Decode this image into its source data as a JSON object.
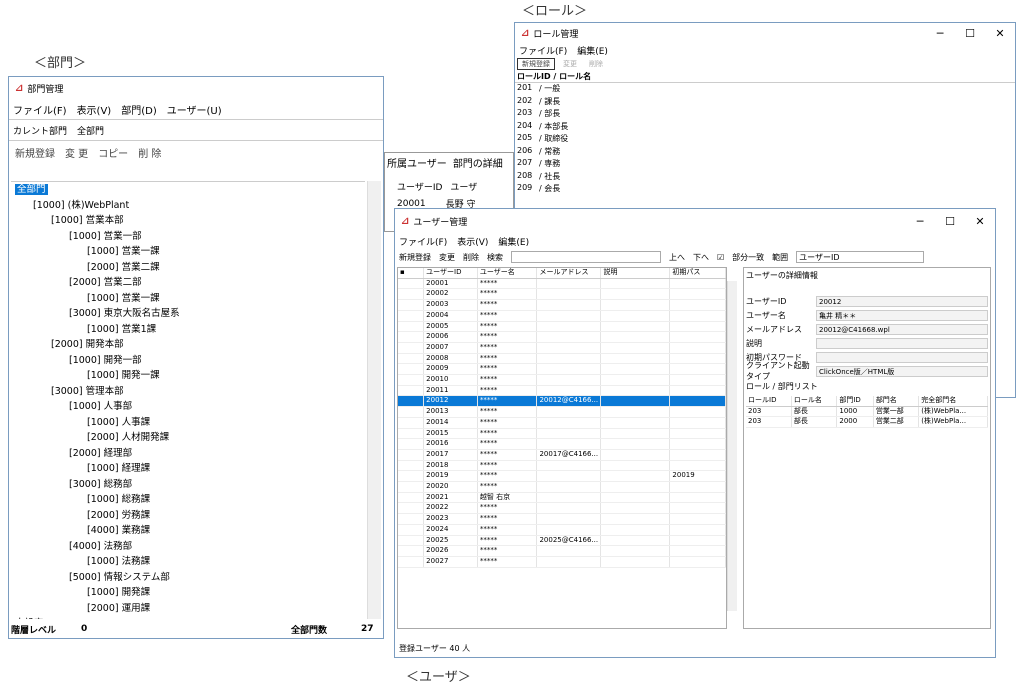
{
  "labels": {
    "role": "＜ロール＞",
    "dept": "＜部門＞",
    "user": "＜ユーザ＞"
  },
  "controls": {
    "min": "─",
    "max": "☐",
    "close": "✕"
  },
  "icons": {
    "app": "app-logo-icon"
  },
  "role_win": {
    "title": "ロール管理",
    "menu": [
      "ファイル(F)",
      "編集(E)"
    ],
    "toolbar": [
      "新規登録",
      "変更",
      "削除"
    ],
    "header": "ロールID / ロール名",
    "rows": [
      [
        "201",
        "/ 一般"
      ],
      [
        "202",
        "/ 課長"
      ],
      [
        "203",
        "/ 部長"
      ],
      [
        "204",
        "/ 本部長"
      ],
      [
        "205",
        "/ 取締役"
      ],
      [
        "206",
        "/ 常務"
      ],
      [
        "207",
        "/ 専務"
      ],
      [
        "208",
        "/ 社長"
      ],
      [
        "209",
        "/ 会長"
      ]
    ]
  },
  "dept_win": {
    "title": "部門管理",
    "menu": [
      "ファイル(F)",
      "表示(V)",
      "部門(D)",
      "ユーザー(U)"
    ],
    "tabs": [
      "カレント部門",
      "全部門"
    ],
    "toolbar": [
      "新規登録",
      "変 更",
      "コピー",
      "削 除"
    ],
    "tree": [
      {
        "t": "全部門",
        "d": 0,
        "sel": true
      },
      {
        "t": "[1000] (株)WebPlant",
        "d": 1
      },
      {
        "t": "[1000] 営業本部",
        "d": 2
      },
      {
        "t": "[1000] 営業一部",
        "d": 3
      },
      {
        "t": "[1000] 営業一課",
        "d": 4
      },
      {
        "t": "[2000] 営業二課",
        "d": 4
      },
      {
        "t": "[2000] 営業二部",
        "d": 3
      },
      {
        "t": "[1000] 営業一課",
        "d": 4
      },
      {
        "t": "[3000] 東京大阪名古屋系",
        "d": 3
      },
      {
        "t": "[1000] 営業1課",
        "d": 4
      },
      {
        "t": "[2000] 開発本部",
        "d": 2
      },
      {
        "t": "[1000] 開発一部",
        "d": 3
      },
      {
        "t": "[1000] 開発一課",
        "d": 4
      },
      {
        "t": "[3000] 管理本部",
        "d": 2
      },
      {
        "t": "[1000] 人事部",
        "d": 3
      },
      {
        "t": "[1000] 人事課",
        "d": 4
      },
      {
        "t": "[2000] 人材開発課",
        "d": 4
      },
      {
        "t": "[2000] 経理部",
        "d": 3
      },
      {
        "t": "[1000] 経理課",
        "d": 4
      },
      {
        "t": "[3000] 総務部",
        "d": 3
      },
      {
        "t": "[1000] 総務課",
        "d": 4
      },
      {
        "t": "[2000] 労務課",
        "d": 4
      },
      {
        "t": "[4000] 業務課",
        "d": 4
      },
      {
        "t": "[4000] 法務部",
        "d": 3
      },
      {
        "t": "[1000] 法務課",
        "d": 4
      },
      {
        "t": "[5000] 情報システム部",
        "d": 3
      },
      {
        "t": "[1000] 開発課",
        "d": 4
      },
      {
        "t": "[2000] 運用課",
        "d": 4
      },
      {
        "t": "未設定",
        "d": 0
      }
    ],
    "status": {
      "level_label": "階層レベル",
      "level": "0",
      "count_label": "全部門数",
      "count": "27"
    },
    "right_tabs": [
      "所属ユーザー",
      "部門の詳細"
    ],
    "user_head": [
      "ユーザーID",
      "ユーザ"
    ],
    "user_rows": [
      [
        "20001",
        "長野 守"
      ]
    ]
  },
  "user_win": {
    "title": "ユーザー管理",
    "menu": [
      "ファイル(F)",
      "表示(V)",
      "編集(E)"
    ],
    "toolbar": [
      "新規登録",
      "変更",
      "削除"
    ],
    "search_label": "検索",
    "search_value": "",
    "nav": [
      "上へ",
      "下へ"
    ],
    "partial": "部分一致",
    "range_label": "範囲",
    "range_value": "ユーザーID",
    "headers": [
      "▪",
      "ユーザーID",
      "ユーザー名",
      "メールアドレス",
      "説明",
      "初期パス"
    ],
    "rows": [
      [
        "",
        "20001",
        "*****",
        "",
        "",
        ""
      ],
      [
        "",
        "20002",
        "*****",
        "",
        "",
        ""
      ],
      [
        "",
        "20003",
        "*****",
        "",
        "",
        ""
      ],
      [
        "",
        "20004",
        "*****",
        "",
        "",
        ""
      ],
      [
        "",
        "20005",
        "*****",
        "",
        "",
        ""
      ],
      [
        "",
        "20006",
        "*****",
        "",
        "",
        ""
      ],
      [
        "",
        "20007",
        "*****",
        "",
        "",
        ""
      ],
      [
        "",
        "20008",
        "*****",
        "",
        "",
        ""
      ],
      [
        "",
        "20009",
        "*****",
        "",
        "",
        ""
      ],
      [
        "",
        "20010",
        "*****",
        "",
        "",
        ""
      ],
      [
        "",
        "20011",
        "*****",
        "",
        "",
        ""
      ],
      [
        "",
        "20012",
        "*****",
        "20012@C4166...",
        "",
        ""
      ],
      [
        "",
        "20013",
        "*****",
        "",
        "",
        ""
      ],
      [
        "",
        "20014",
        "*****",
        "",
        "",
        ""
      ],
      [
        "",
        "20015",
        "*****",
        "",
        "",
        ""
      ],
      [
        "",
        "20016",
        "*****",
        "",
        "",
        ""
      ],
      [
        "",
        "20017",
        "*****",
        "20017@C4166...",
        "",
        ""
      ],
      [
        "",
        "20018",
        "*****",
        "",
        "",
        ""
      ],
      [
        "",
        "20019",
        "*****",
        "",
        "",
        "20019"
      ],
      [
        "",
        "20020",
        "*****",
        "",
        "",
        ""
      ],
      [
        "",
        "20021",
        "越智 右京",
        "",
        "",
        ""
      ],
      [
        "",
        "20022",
        "*****",
        "",
        "",
        ""
      ],
      [
        "",
        "20023",
        "*****",
        "",
        "",
        ""
      ],
      [
        "",
        "20024",
        "*****",
        "",
        "",
        ""
      ],
      [
        "",
        "20025",
        "*****",
        "20025@C4166...",
        "",
        ""
      ],
      [
        "",
        "20026",
        "*****",
        "",
        "",
        ""
      ],
      [
        "",
        "20027",
        "*****",
        "",
        "",
        ""
      ]
    ],
    "selected_index": 11,
    "detail": {
      "tab": "ユーザーの詳細情報",
      "fields": [
        {
          "label": "ユーザーID",
          "value": "20012"
        },
        {
          "label": "ユーザー名",
          "value": "亀井 精＊＊"
        },
        {
          "label": "メールアドレス",
          "value": "20012@C41668.wpl"
        },
        {
          "label": "説明",
          "value": ""
        },
        {
          "label": "初期パスワード",
          "value": ""
        },
        {
          "label": "クライアント起動タイプ",
          "value": "ClickOnce版／HTML版"
        }
      ],
      "role_list_label": "ロール / 部門リスト",
      "role_head": [
        "ロールID",
        "ロール名",
        "部門ID",
        "部門名",
        "完全部門名"
      ],
      "role_rows": [
        [
          "203",
          "部長",
          "1000",
          "営業一部",
          "(株)WebPla..."
        ],
        [
          "203",
          "部長",
          "2000",
          "営業二部",
          "(株)WebPla..."
        ]
      ]
    },
    "status": "登録ユーザー 40 人"
  }
}
